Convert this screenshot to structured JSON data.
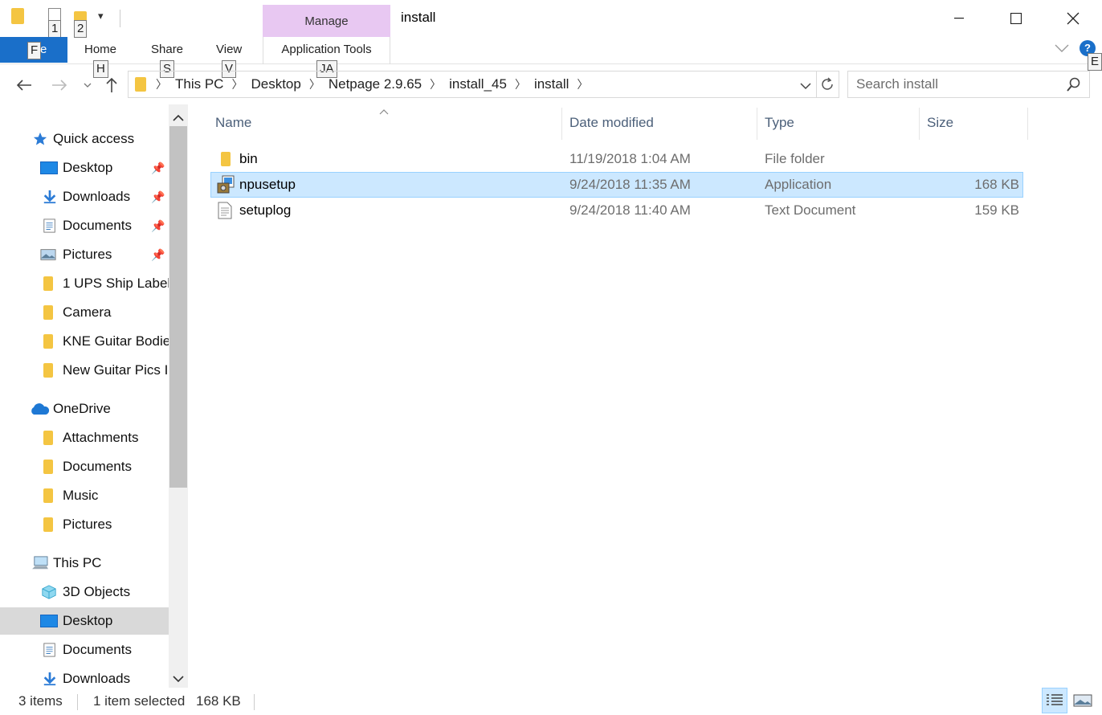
{
  "window": {
    "title": "install",
    "context_tab": "Manage",
    "controls": {
      "minimize": "—",
      "maximize": "☐",
      "close": "✕"
    }
  },
  "quick_access_toolbar": {
    "keytips": [
      "1",
      "2"
    ]
  },
  "ribbon": {
    "file_label": "File",
    "file_keytip": "F",
    "tabs": [
      {
        "label": "Home",
        "keytip": "H"
      },
      {
        "label": "Share",
        "keytip": "S"
      },
      {
        "label": "View",
        "keytip": "V"
      },
      {
        "label": "Application Tools",
        "keytip": "JA"
      }
    ],
    "help_keytip": "E",
    "help_label": "?"
  },
  "address_bar": {
    "breadcrumbs": [
      "This PC",
      "Desktop",
      "Netpage 2.9.65",
      "install_45",
      "install"
    ]
  },
  "search": {
    "placeholder": "Search install"
  },
  "nav_pane": {
    "quick_access": {
      "label": "Quick access",
      "items": [
        {
          "label": "Desktop",
          "icon": "desktop-icon",
          "pinned": true
        },
        {
          "label": "Downloads",
          "icon": "downloads-icon",
          "pinned": true
        },
        {
          "label": "Documents",
          "icon": "documents-icon",
          "pinned": true
        },
        {
          "label": "Pictures",
          "icon": "pictures-icon",
          "pinned": true
        },
        {
          "label": "1 UPS Ship Label",
          "icon": "folder-icon",
          "pinned": false
        },
        {
          "label": "Camera",
          "icon": "folder-icon",
          "pinned": false
        },
        {
          "label": "KNE Guitar Bodie",
          "icon": "folder-icon",
          "pinned": false
        },
        {
          "label": "New Guitar Pics I",
          "icon": "folder-icon",
          "pinned": false
        }
      ]
    },
    "onedrive": {
      "label": "OneDrive",
      "items": [
        {
          "label": "Attachments",
          "icon": "folder-icon"
        },
        {
          "label": "Documents",
          "icon": "folder-icon"
        },
        {
          "label": "Music",
          "icon": "folder-icon"
        },
        {
          "label": "Pictures",
          "icon": "folder-icon"
        }
      ]
    },
    "this_pc": {
      "label": "This PC",
      "items": [
        {
          "label": "3D Objects",
          "icon": "3d-objects-icon"
        },
        {
          "label": "Desktop",
          "icon": "desktop-icon",
          "selected": true
        },
        {
          "label": "Documents",
          "icon": "documents-icon"
        },
        {
          "label": "Downloads",
          "icon": "downloads-icon"
        }
      ]
    }
  },
  "file_list": {
    "columns": [
      "Name",
      "Date modified",
      "Type",
      "Size"
    ],
    "rows": [
      {
        "name": "bin",
        "date": "11/19/2018 1:04 AM",
        "type": "File folder",
        "size": "",
        "icon": "folder-icon",
        "selected": false
      },
      {
        "name": "npusetup",
        "date": "9/24/2018 11:35 AM",
        "type": "Application",
        "size": "168 KB",
        "icon": "setup-exe-icon",
        "selected": true
      },
      {
        "name": "setuplog",
        "date": "9/24/2018 11:40 AM",
        "type": "Text Document",
        "size": "159 KB",
        "icon": "text-file-icon",
        "selected": false
      }
    ]
  },
  "status_bar": {
    "item_count": "3 items",
    "selection": "1 item selected",
    "selection_size": "168 KB"
  },
  "colors": {
    "file_tab": "#1a6fc9",
    "manage_tab": "#e8c8f2",
    "selected_row": "#cce8ff",
    "folder": "#f4c542",
    "header_text": "#4c607a"
  }
}
